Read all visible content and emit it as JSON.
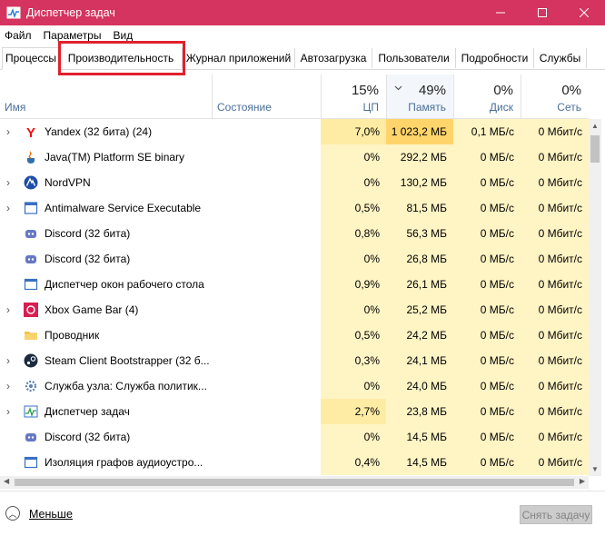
{
  "window": {
    "title": "Диспетчер задач"
  },
  "menu": [
    "Файл",
    "Параметры",
    "Вид"
  ],
  "tabs": [
    {
      "label": "Процессы",
      "active": true
    },
    {
      "label": "Производительность"
    },
    {
      "label": "Журнал приложений"
    },
    {
      "label": "Автозагрузка"
    },
    {
      "label": "Пользователи"
    },
    {
      "label": "Подробности"
    },
    {
      "label": "Службы"
    }
  ],
  "columns": {
    "name": "Имя",
    "status": "Состояние",
    "cpu": {
      "label": "ЦП",
      "pct": "15%"
    },
    "memory": {
      "label": "Память",
      "pct": "49%"
    },
    "disk": {
      "label": "Диск",
      "pct": "0%"
    },
    "network": {
      "label": "Сеть",
      "pct": "0%"
    }
  },
  "processes": [
    {
      "name": "Yandex (32 бита) (24)",
      "cpu": "7,0%",
      "mem": "1 023,2 МБ",
      "disk": "0,1 МБ/с",
      "net": "0 Мбит/с",
      "icon": "yandex-icon",
      "expand": true
    },
    {
      "name": "Java(TM) Platform SE binary",
      "cpu": "0%",
      "mem": "292,2 МБ",
      "disk": "0 МБ/с",
      "net": "0 Мбит/с",
      "icon": "java-icon",
      "expand": false
    },
    {
      "name": "NordVPN",
      "cpu": "0%",
      "mem": "130,2 МБ",
      "disk": "0 МБ/с",
      "net": "0 Мбит/с",
      "icon": "nordvpn-icon",
      "expand": true
    },
    {
      "name": "Antimalware Service Executable",
      "cpu": "0,5%",
      "mem": "81,5 МБ",
      "disk": "0 МБ/с",
      "net": "0 Мбит/с",
      "icon": "shield-app-icon",
      "expand": true
    },
    {
      "name": "Discord (32 бита)",
      "cpu": "0,8%",
      "mem": "56,3 МБ",
      "disk": "0 МБ/с",
      "net": "0 Мбит/с",
      "icon": "discord-icon",
      "expand": false
    },
    {
      "name": "Discord (32 бита)",
      "cpu": "0%",
      "mem": "26,8 МБ",
      "disk": "0 МБ/с",
      "net": "0 Мбит/с",
      "icon": "discord-icon",
      "expand": false
    },
    {
      "name": "Диспетчер окон рабочего стола",
      "cpu": "0,9%",
      "mem": "26,1 МБ",
      "disk": "0 МБ/с",
      "net": "0 Мбит/с",
      "icon": "window-manager-icon",
      "expand": false
    },
    {
      "name": "Xbox Game Bar (4)",
      "cpu": "0%",
      "mem": "25,2 МБ",
      "disk": "0 МБ/с",
      "net": "0 Мбит/с",
      "icon": "xbox-game-bar-icon",
      "expand": true
    },
    {
      "name": "Проводник",
      "cpu": "0,5%",
      "mem": "24,2 МБ",
      "disk": "0 МБ/с",
      "net": "0 Мбит/с",
      "icon": "folder-icon",
      "expand": false
    },
    {
      "name": "Steam Client Bootstrapper (32 б...",
      "cpu": "0,3%",
      "mem": "24,1 МБ",
      "disk": "0 МБ/с",
      "net": "0 Мбит/с",
      "icon": "steam-icon",
      "expand": true
    },
    {
      "name": "Служба узла: Служба политик...",
      "cpu": "0%",
      "mem": "24,0 МБ",
      "disk": "0 МБ/с",
      "net": "0 Мбит/с",
      "icon": "gear-icon",
      "expand": true
    },
    {
      "name": "Диспетчер задач",
      "cpu": "2,7%",
      "mem": "23,8 МБ",
      "disk": "0 МБ/с",
      "net": "0 Мбит/с",
      "icon": "task-manager-icon",
      "expand": true
    },
    {
      "name": "Discord (32 бита)",
      "cpu": "0%",
      "mem": "14,5 МБ",
      "disk": "0 МБ/с",
      "net": "0 Мбит/с",
      "icon": "discord-icon",
      "expand": false
    },
    {
      "name": "Изоляция графов аудиоустро...",
      "cpu": "0,4%",
      "mem": "14,5 МБ",
      "disk": "0 МБ/с",
      "net": "0 Мбит/с",
      "icon": "audio-icon",
      "expand": false
    }
  ],
  "footer": {
    "less": "Меньше",
    "end_task": "Снять задачу"
  },
  "colors": {
    "titlebar": "#d4345f",
    "highlight": "#e0212b",
    "cell_light": "#fff4c4",
    "cell_strong": "#ffd56b"
  }
}
